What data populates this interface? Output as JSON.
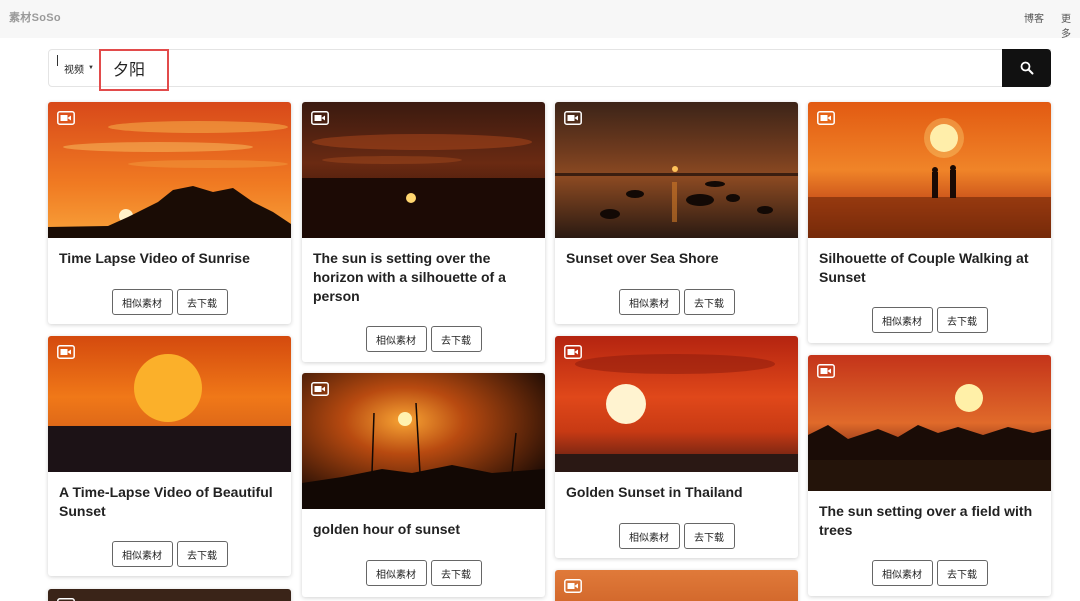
{
  "header": {
    "brand": "素材SoSo",
    "nav": {
      "blog": "博客",
      "more": "更多"
    }
  },
  "search": {
    "type_label": "视频",
    "query": "夕阳",
    "button_icon": "search-icon"
  },
  "card_buttons": {
    "similar": "相似素材",
    "download": "去下载"
  },
  "badge_icon": "video-camera-icon",
  "results": [
    {
      "title": "Time Lapse Video of Sunrise"
    },
    {
      "title": "The sun is setting over the horizon with a silhouette of a person"
    },
    {
      "title": "Sunset over Sea Shore"
    },
    {
      "title": "Silhouette of Couple Walking at Sunset"
    },
    {
      "title": "A Time-Lapse Video of Beautiful Sunset"
    },
    {
      "title": "golden hour of sunset"
    },
    {
      "title": "Golden Sunset in Thailand"
    },
    {
      "title": "The sun setting over a field with trees"
    }
  ],
  "colors": {
    "accent_red": "#e24b4b",
    "search_button": "#111111",
    "topbar": "#f7f7f7"
  }
}
